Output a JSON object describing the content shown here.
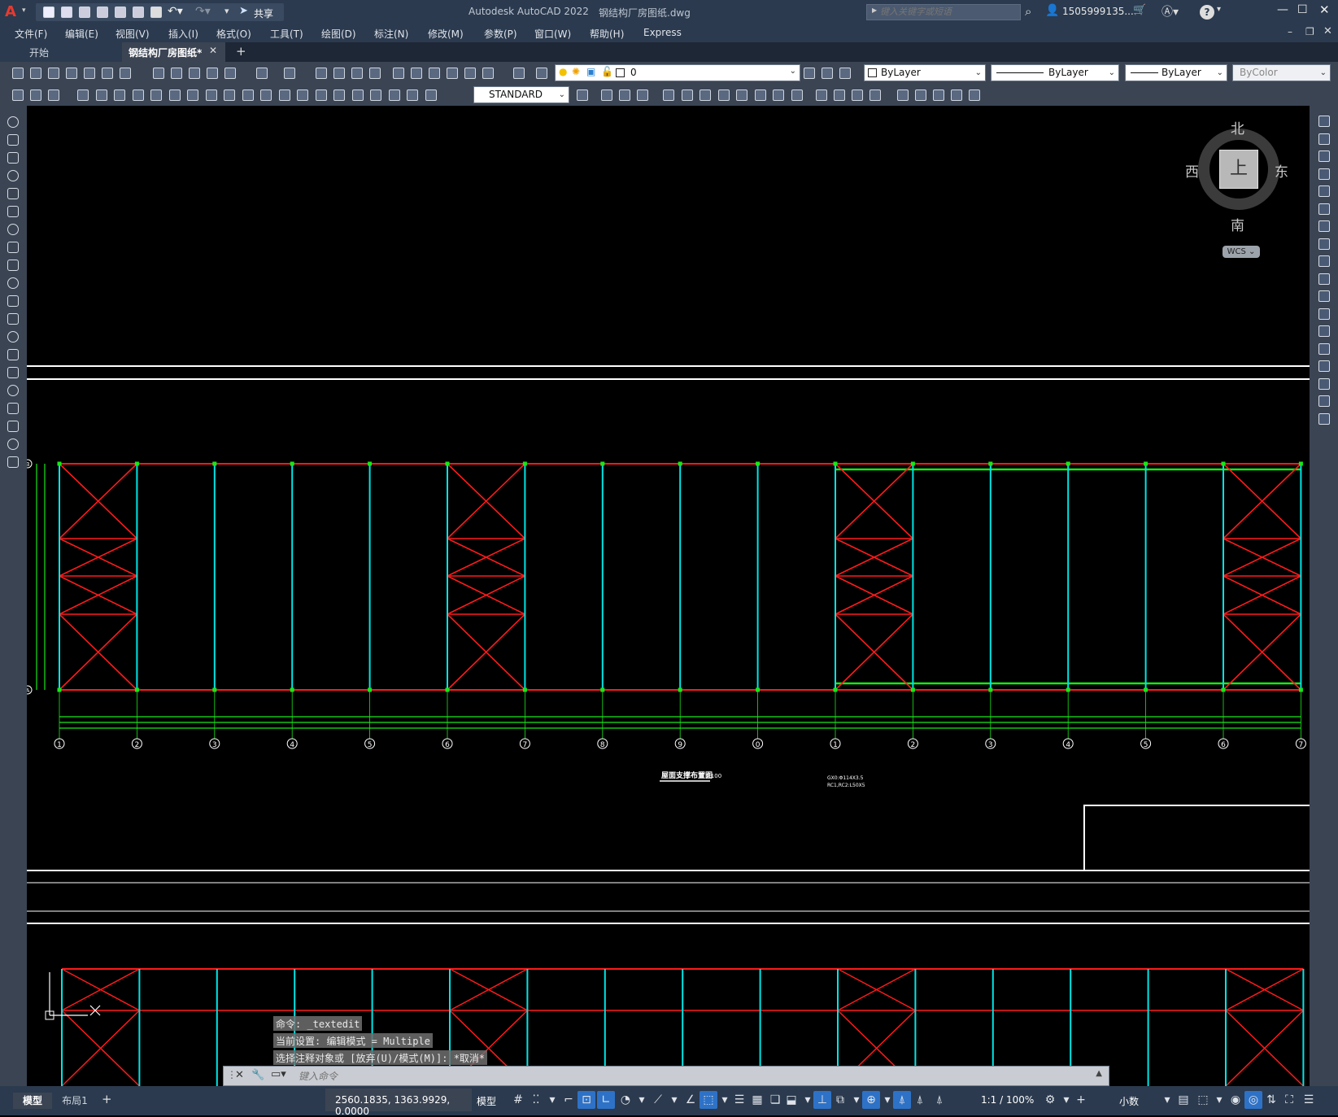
{
  "app": {
    "logo_text": "A",
    "title": "Autodesk AutoCAD 2022",
    "document_name": "钢结构厂房图纸.dwg",
    "share_label": "共享",
    "search_placeholder": "键入关键字或短语",
    "user_name": "1505999135...",
    "help_label": "?"
  },
  "menu": {
    "items": [
      "文件(F)",
      "编辑(E)",
      "视图(V)",
      "插入(I)",
      "格式(O)",
      "工具(T)",
      "绘图(D)",
      "标注(N)",
      "修改(M)",
      "参数(P)",
      "窗口(W)",
      "帮助(H)",
      "Express"
    ]
  },
  "tabs": {
    "items": [
      {
        "label": "开始",
        "active": false
      },
      {
        "label": "钢结构厂房图纸*",
        "active": true
      }
    ],
    "add_label": "+"
  },
  "toolbar": {
    "layer_value": "0",
    "color_value": "ByLayer",
    "linetype_value": "ByLayer",
    "lineweight_value": "ByLayer",
    "plotstyle_value": "ByColor",
    "textstyle_value": "STANDARD"
  },
  "viewcube": {
    "north": "北",
    "south": "南",
    "east": "东",
    "west": "西",
    "face": "上",
    "wcs": "WCS"
  },
  "drawing": {
    "plan_title": "屋面支撑布置图",
    "plan_scale": "1:100",
    "note_line1": "GX0:Φ114X3.5",
    "note_line2": "RC1,RC2:L50X5",
    "axis_labels": [
      "1",
      "2",
      "3",
      "4",
      "5",
      "6",
      "7",
      "8",
      "9",
      "0",
      "1",
      "2",
      "3",
      "4",
      "5",
      "6",
      "7"
    ],
    "row_labels": [
      "B",
      "A"
    ],
    "colors": {
      "beam": "#ff1a1a",
      "column": "#00e5e5",
      "tie": "#19e619",
      "border": "#ffffff"
    }
  },
  "command": {
    "history": [
      "命令: _textedit",
      "当前设置: 编辑模式 = Multiple",
      "选择注释对象或 [放弃(U)/模式(M)]: *取消*"
    ],
    "placeholder": "键入命令"
  },
  "status": {
    "layout_tabs": [
      "模型",
      "布局1"
    ],
    "add_layout": "+",
    "coordinates": "2560.1835, 1363.9929, 0.0000",
    "space_label": "模型",
    "annotation_scale": "1:1 / 100%",
    "units_label": "小数"
  }
}
